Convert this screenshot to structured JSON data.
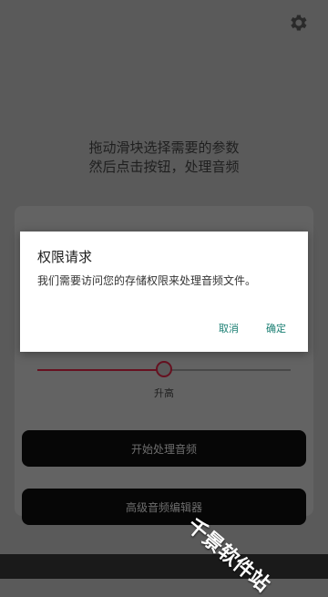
{
  "colors": {
    "background": "#5a5a5a",
    "button": "#060606",
    "slider_accent": "#661120",
    "dialog_action": "#1a7f73"
  },
  "header": {
    "settings_icon": "gear-icon"
  },
  "main": {
    "instructions": [
      "拖动滑块选择需要的参数",
      "然后点击按钮，处理音频"
    ],
    "slider": {
      "label": "升高",
      "value_fraction": 0.5
    },
    "start_button": "开始处理音频",
    "editor_button": "高级音频编辑器"
  },
  "dialog": {
    "title": "权限请求",
    "message": "我们需要访问您的存储权限来处理音频文件。",
    "cancel": "取消",
    "ok": "确定"
  },
  "watermark": "千景软件站"
}
